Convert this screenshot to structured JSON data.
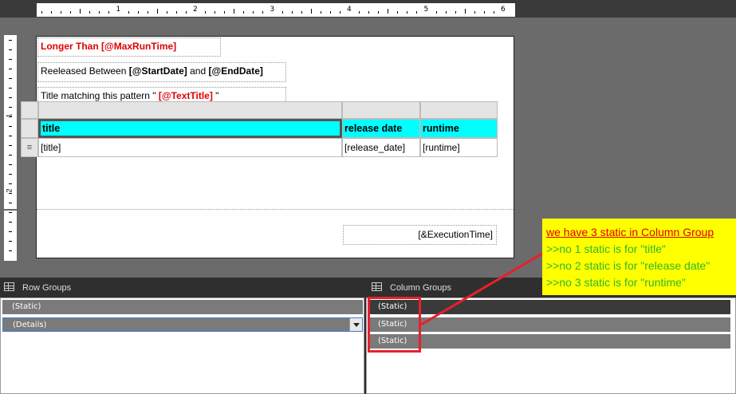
{
  "ruler": {
    "marks": [
      "1",
      "2",
      "3",
      "4",
      "5",
      "6"
    ],
    "vmark": "1",
    "vmark2": "2"
  },
  "report": {
    "title_line": {
      "prefix": "Longer Than ",
      "param": "[@MaxRunTime]"
    },
    "released_line": {
      "prefix": "Reeleased Between ",
      "start": "[@StartDate]",
      "and": " and ",
      "end": "[@EndDate]"
    },
    "pattern_line": {
      "prefix": "Title matching this pattern \" ",
      "param": "[@TextTitle]",
      "suffix": " \""
    },
    "table": {
      "row_handle_icon": "≡",
      "headers": [
        "title",
        "release date",
        "runtime"
      ],
      "cells": [
        "[title]",
        "[release_date]",
        "[runtime]"
      ]
    },
    "execution_time": "[&ExecutionTime]"
  },
  "row_groups": {
    "title": "Row Groups",
    "items": [
      "(Static)",
      "(Details)"
    ]
  },
  "column_groups": {
    "title": "Column Groups",
    "items": [
      "(Static)",
      "(Static)",
      "(Static)"
    ]
  },
  "annotation": {
    "heading": "we have 3 static in Column Group",
    "lines": [
      ">>no 1 static is for \"title\"",
      ">>no 2 static is for \"release date\"",
      ">>no 3 static is for \"runtime\""
    ]
  },
  "colors": {
    "highlight": "#00ffff",
    "param_red": "#e00000",
    "note_bg": "#ffff00",
    "note_green": "#2cb82c",
    "callout_red": "#e8202a"
  }
}
